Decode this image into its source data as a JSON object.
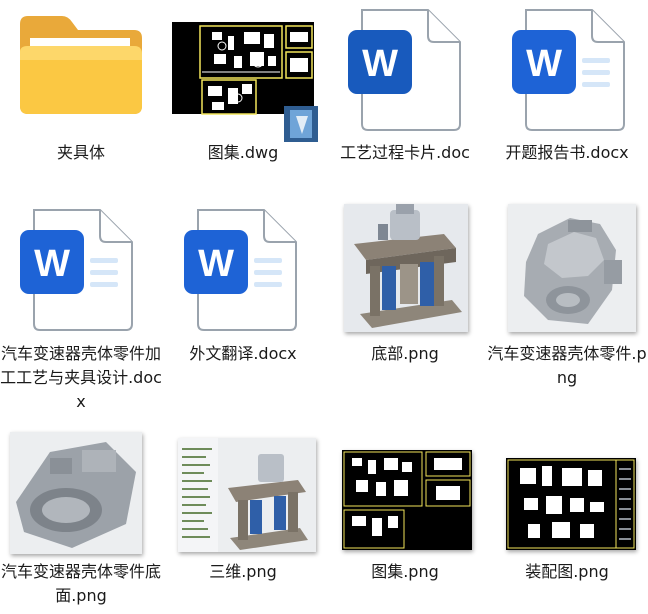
{
  "files": [
    {
      "label": "夹具体",
      "kind": "folder",
      "icon": "folder-icon"
    },
    {
      "label": "图集.dwg",
      "kind": "dwg",
      "icon": "dwg-file-icon"
    },
    {
      "label": "工艺过程卡片.doc",
      "kind": "word-outline",
      "icon": "word-doc-icon",
      "badge": "W"
    },
    {
      "label": "开题报告书.docx",
      "kind": "word",
      "icon": "word-docx-icon",
      "badge": "W"
    },
    {
      "label": "汽车变速器壳体零件加工工艺与夹具设计.docx",
      "kind": "word",
      "icon": "word-docx-icon",
      "badge": "W"
    },
    {
      "label": "外文翻译.docx",
      "kind": "word",
      "icon": "word-docx-icon",
      "badge": "W"
    },
    {
      "label": "底部.png",
      "kind": "png-fixture",
      "icon": "image-thumbnail-icon"
    },
    {
      "label": "汽车变速器壳体零件.png",
      "kind": "png-housing",
      "icon": "image-thumbnail-icon"
    },
    {
      "label": "汽车变速器壳体零件底面.png",
      "kind": "png-housing-bottom",
      "icon": "image-thumbnail-icon"
    },
    {
      "label": "三维.png",
      "kind": "png-cad",
      "icon": "image-thumbnail-icon"
    },
    {
      "label": "图集.png",
      "kind": "png-drawings",
      "icon": "image-thumbnail-icon"
    },
    {
      "label": "装配图.png",
      "kind": "png-assembly",
      "icon": "image-thumbnail-icon"
    }
  ],
  "colors": {
    "folder_back": "#E9A93A",
    "folder_front": "#FBC843",
    "word_blue": "#185ABD",
    "word_light": "#41A5EE",
    "doc_outline": "#9AA3AD"
  }
}
